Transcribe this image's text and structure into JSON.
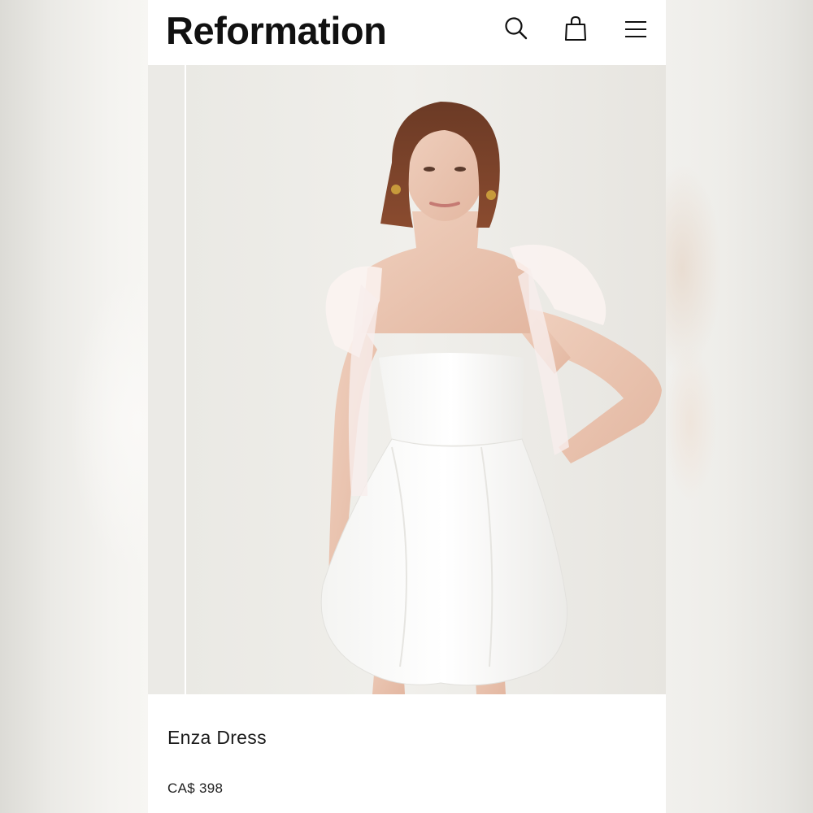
{
  "brand": {
    "logo_text": "Reformation"
  },
  "header": {
    "icons": [
      "search-icon",
      "shopping-bag-icon",
      "menu-icon"
    ]
  },
  "product": {
    "name": "Enza Dress",
    "price": "CA$ 398",
    "image_description_icon": "product-photo"
  },
  "colors": {
    "text": "#111111",
    "background": "#ffffff",
    "photo_backdrop": "#efeeea"
  }
}
